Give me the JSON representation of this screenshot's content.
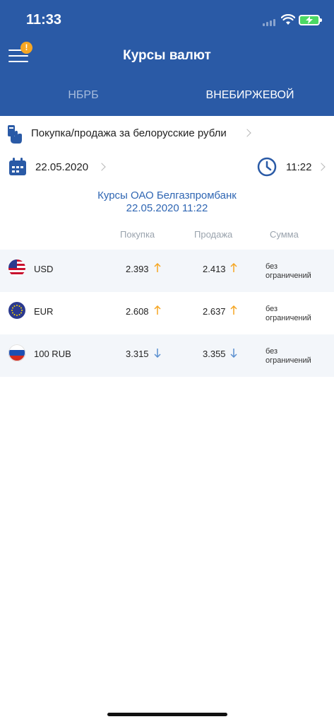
{
  "status": {
    "time": "11:33"
  },
  "header": {
    "title": "Курсы валют",
    "badge": "!",
    "tabs": [
      {
        "label": "НБРБ",
        "active": false
      },
      {
        "label": "ВНЕБИРЖЕВОЙ",
        "active": true
      }
    ]
  },
  "filters": {
    "operation": "Покупка/продажа за белорусские рубли",
    "date": "22.05.2020",
    "time": "11:22"
  },
  "bank": {
    "line1": "Курсы ОАО Белгазпромбанк",
    "line2": "22.05.2020 11:22"
  },
  "table": {
    "columns": [
      "Покупка",
      "Продажа",
      "Сумма"
    ],
    "rows": [
      {
        "code": "USD",
        "buy": "2.393",
        "sell": "2.413",
        "buy_trend": "up",
        "sell_trend": "up",
        "sum_line1": "без",
        "sum_line2": "ограничений"
      },
      {
        "code": "EUR",
        "buy": "2.608",
        "sell": "2.637",
        "buy_trend": "up",
        "sell_trend": "up",
        "sum_line1": "без",
        "sum_line2": "ограничений"
      },
      {
        "code": "100 RUB",
        "buy": "3.315",
        "sell": "3.355",
        "buy_trend": "down",
        "sell_trend": "down",
        "sum_line1": "без",
        "sum_line2": "ограничений"
      }
    ]
  },
  "colors": {
    "header_bg": "#2a5aa6",
    "accent_blue": "#2f66b3",
    "up_arrow": "#f6a623",
    "down_arrow": "#5b8fd0",
    "badge": "#f6a623"
  },
  "icons": {
    "menu": "menu-icon",
    "card": "card-hand-icon",
    "calendar": "calendar-icon",
    "clock": "clock-icon",
    "flags": [
      "us-flag-icon",
      "eu-flag-icon",
      "ru-flag-icon"
    ]
  }
}
